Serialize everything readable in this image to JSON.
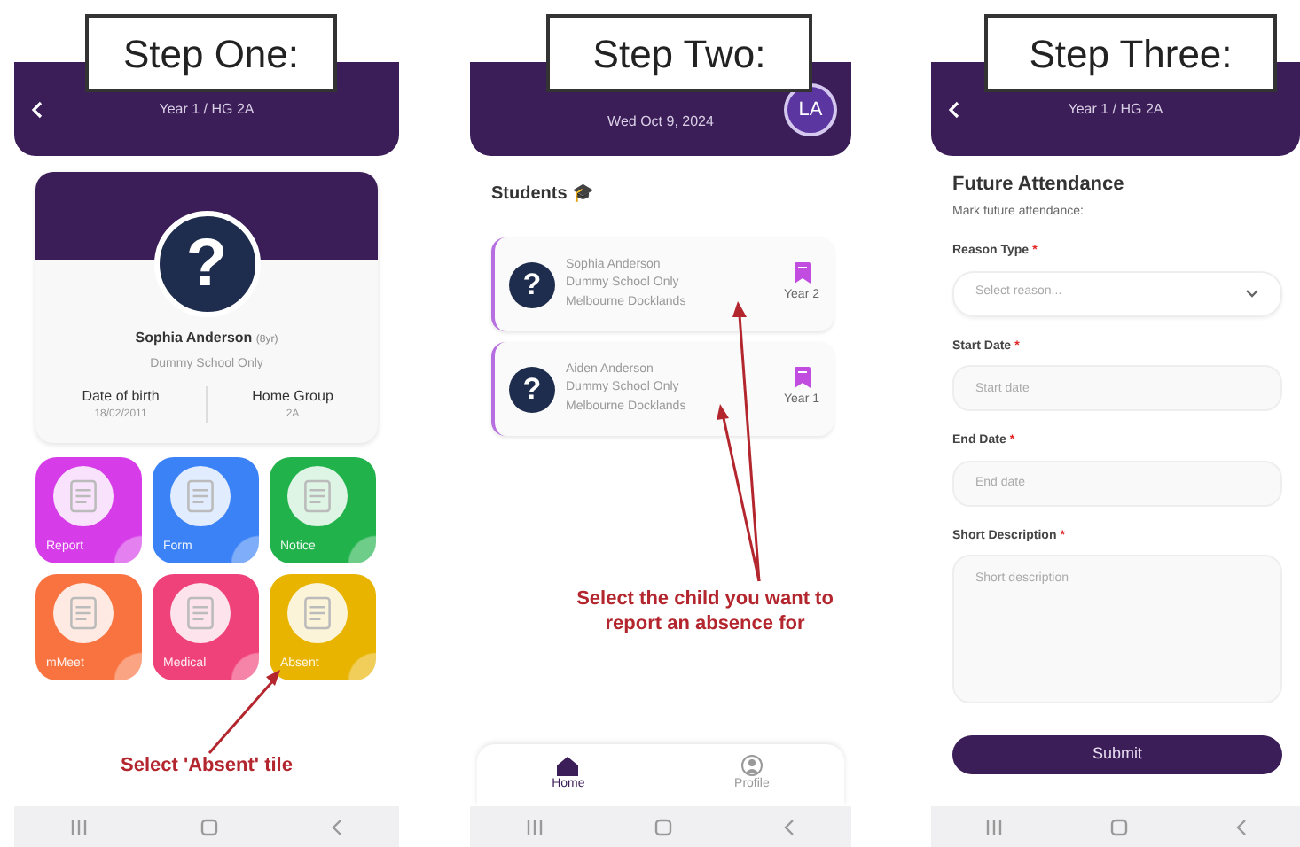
{
  "screens": [
    {
      "kind": "profile",
      "step_label": "Step One:",
      "header": {
        "title": "Year 1 / HG 2A"
      },
      "profile": {
        "avatar_symbol": "?",
        "name": "Sophia Anderson",
        "age": "(8yr)",
        "school": "Dummy School Only",
        "stats": [
          {
            "label": "Date of birth",
            "value": "18/02/2011"
          },
          {
            "label": "Home Group",
            "value": "2A"
          }
        ]
      },
      "tiles": [
        {
          "label": "Report",
          "color": "#d63ce8"
        },
        {
          "label": "Form",
          "color": "#3b82f6"
        },
        {
          "label": "Notice",
          "color": "#22b24c"
        },
        {
          "label": "mMeet",
          "color": "#f97340"
        },
        {
          "label": "Medical",
          "color": "#f0427a"
        },
        {
          "label": "Absent",
          "color": "#e8b400"
        }
      ],
      "annotation": "Select 'Absent' tile"
    },
    {
      "kind": "students",
      "step_label": "Step Two:",
      "header": {
        "date": "Wed Oct 9, 2024",
        "avatar_initials": "LA"
      },
      "section_title": "Students 🎓",
      "students": [
        {
          "avatar_symbol": "?",
          "name": "Sophia Anderson",
          "school": "Dummy School Only",
          "campus": "Melbourne Docklands",
          "year": "Year 2"
        },
        {
          "avatar_symbol": "?",
          "name": "Aiden Anderson",
          "school": "Dummy School Only",
          "campus": "Melbourne Docklands",
          "year": "Year 1"
        }
      ],
      "annotation": "Select the child you want to report an absence for",
      "bottom_nav": [
        {
          "label": "Home",
          "selected": true
        },
        {
          "label": "Profile",
          "selected": false
        }
      ]
    },
    {
      "kind": "form",
      "step_label": "Step Three:",
      "header": {
        "title": "Year 1 / HG 2A"
      },
      "form_title": "Future Attendance",
      "form_subtitle": "Mark future attendance:",
      "fields": [
        {
          "kind": "select",
          "label": "Reason Type",
          "required_mark": "*",
          "placeholder": "Select reason..."
        },
        {
          "kind": "input",
          "label": "Start Date",
          "required_mark": "*",
          "placeholder": "Start date"
        },
        {
          "kind": "input",
          "label": "End Date",
          "required_mark": "*",
          "placeholder": "End date"
        },
        {
          "kind": "textarea",
          "label": "Short Description",
          "required_mark": "*",
          "placeholder": "Short description"
        }
      ],
      "submit": "Submit"
    }
  ]
}
